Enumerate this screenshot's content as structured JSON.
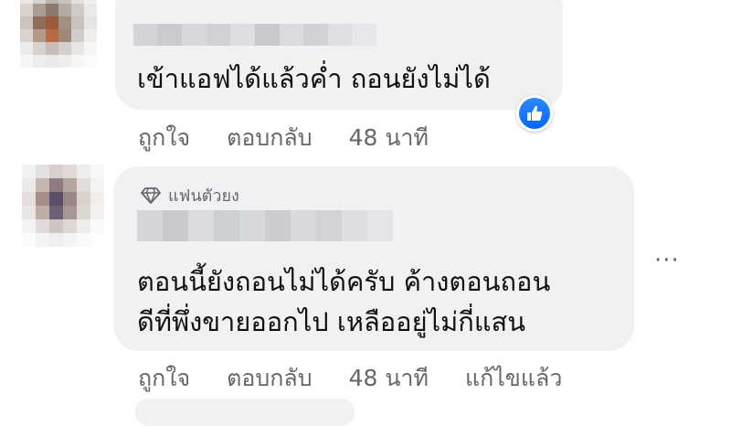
{
  "comments": [
    {
      "text_lines": [
        "เข้าแอฟได้แล้วค่ำ ถอนยังไม่ได้"
      ],
      "actions": {
        "like": "ถูกใจ",
        "reply": "ตอบกลับ",
        "time": "48 นาที"
      },
      "reaction": "like-icon"
    },
    {
      "badge_label": "แฟนตัวยง",
      "text_lines": [
        "ตอนนี้ยังถอนไม่ได้ครับ ค้างตอนถอน",
        "ดีที่พึ่งขายออกไป เหลืออยู่ไม่กี่แสน"
      ],
      "actions": {
        "like": "ถูกใจ",
        "reply": "ตอบกลับ",
        "time": "48 นาที",
        "edited": "แก้ไขแล้ว"
      },
      "more_label": "···"
    }
  ],
  "colors": {
    "bubble": "#eff1f3",
    "muted_text": "#65676b",
    "like_blue": "#0866ff"
  }
}
